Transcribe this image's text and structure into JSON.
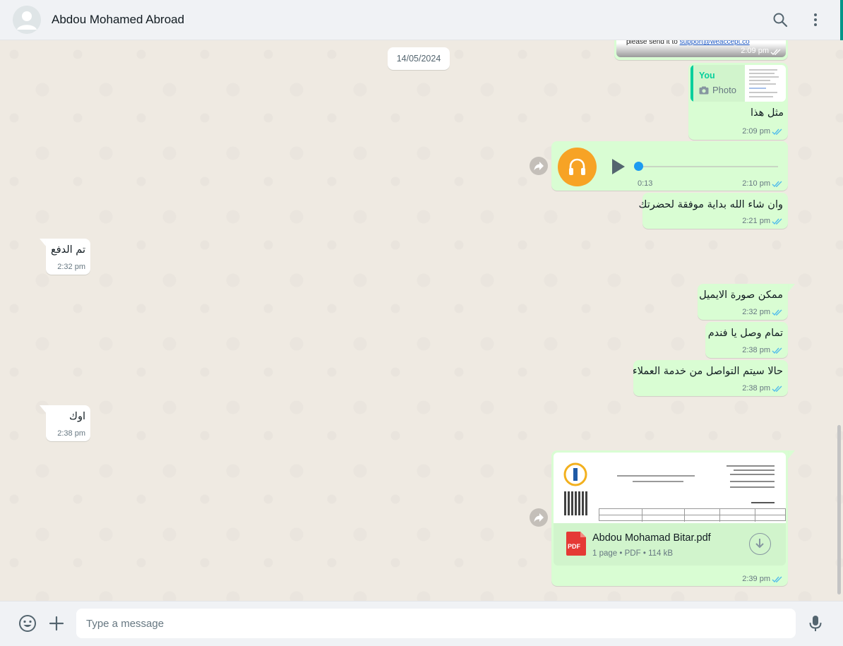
{
  "header": {
    "contact_name": "Abdou Mohamed Abroad",
    "icons": [
      "avatar-default-icon",
      "search-icon",
      "menu-dots-icon"
    ]
  },
  "chat": {
    "date_chip": "14/05/2024",
    "messages": [
      {
        "dir": "out",
        "type": "image-partial",
        "caption_prefix": "please send it to ",
        "caption_link": "support@weaccept.co",
        "time": "2:09 pm",
        "status": "read"
      },
      {
        "dir": "out",
        "type": "reply",
        "quote_author": "You",
        "quote_label": "Photo",
        "text": "مثل هذا",
        "time": "2:09 pm",
        "status": "read"
      },
      {
        "dir": "out",
        "type": "audio",
        "duration": "0:13",
        "progress": 0,
        "time": "2:10 pm",
        "status": "read"
      },
      {
        "dir": "out",
        "type": "text",
        "text": "وان شاء الله بداية موفقة لحضرتك",
        "time": "2:21 pm",
        "status": "read"
      },
      {
        "dir": "in",
        "type": "text",
        "text": "تم الدفع",
        "time": "2:32 pm"
      },
      {
        "dir": "out",
        "type": "text",
        "text": "ممكن صورة الايميل",
        "time": "2:32 pm",
        "status": "read"
      },
      {
        "dir": "out",
        "type": "text",
        "text": "تمام وصل يا فندم",
        "time": "2:38 pm",
        "status": "read"
      },
      {
        "dir": "out",
        "type": "text",
        "text": "حالا سيتم التواصل من خدمة العملاء",
        "time": "2:38 pm",
        "status": "read"
      },
      {
        "dir": "in",
        "type": "text",
        "text": "اوك",
        "time": "2:38 pm"
      },
      {
        "dir": "out",
        "type": "document",
        "file_name": "Abdou Mohamad Bitar.pdf",
        "file_meta_pages": "1 page",
        "file_meta_type": "PDF",
        "file_meta_size": "114 kB",
        "file_badge": "PDF",
        "time": "2:39 pm",
        "status": "read"
      }
    ]
  },
  "composer": {
    "placeholder": "Type a message",
    "icons": [
      "emoji-icon",
      "attach-plus-icon",
      "microphone-icon"
    ]
  },
  "colors": {
    "outgoing_bubble": "#d9fdd3",
    "incoming_bubble": "#ffffff",
    "read_ticks": "#53bdeb",
    "audio_avatar": "#f7a325",
    "reply_accent": "#06cf9c",
    "pdf_icon": "#e53935"
  }
}
